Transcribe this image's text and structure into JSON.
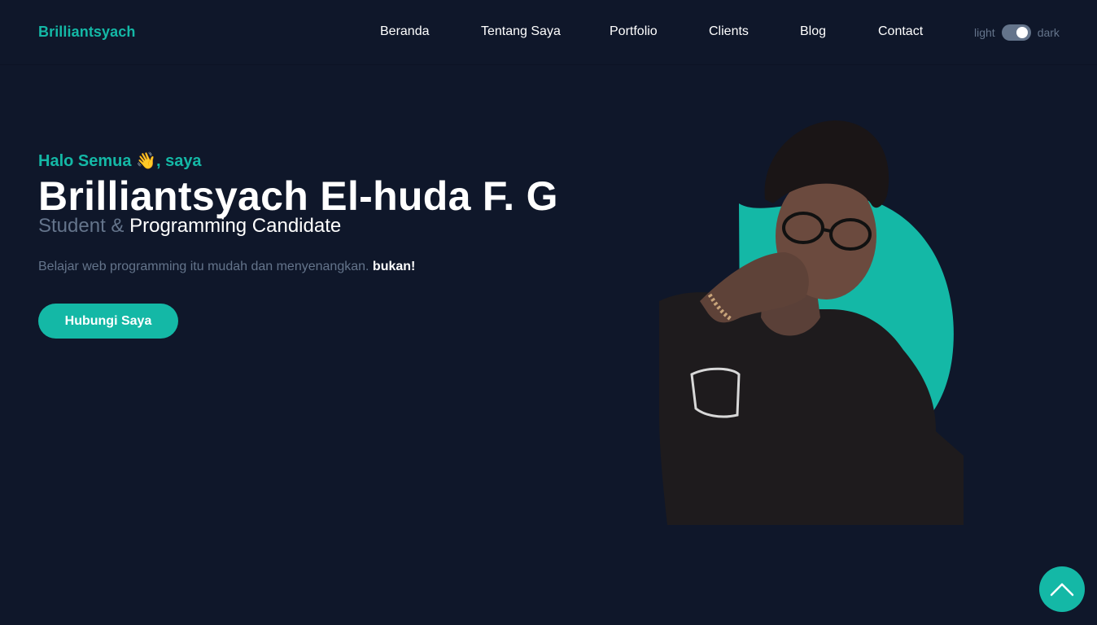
{
  "header": {
    "logo": "Brilliantsyach",
    "nav": [
      "Beranda",
      "Tentang Saya",
      "Portfolio",
      "Clients",
      "Blog",
      "Contact"
    ],
    "theme_toggle": {
      "left_label": "light",
      "right_label": "dark",
      "state": "dark"
    }
  },
  "hero": {
    "greeting_prefix": "Halo Semua",
    "greeting_emoji": "👋",
    "greeting_suffix": ", saya",
    "name": "Brilliantsyach El-huda F. G",
    "subtitle_muted": "Student &",
    "subtitle_bright": "Programming Candidate",
    "tagline_text": "Belajar web programming itu mudah dan menyenangkan.",
    "tagline_emphasis": "bukan!",
    "cta_label": "Hubungi Saya"
  },
  "colors": {
    "background": "#0f172a",
    "accent": "#14b8a6",
    "muted": "#64748b",
    "text": "#ffffff"
  },
  "icons": {
    "back_to_top": "chevron-up-icon"
  }
}
